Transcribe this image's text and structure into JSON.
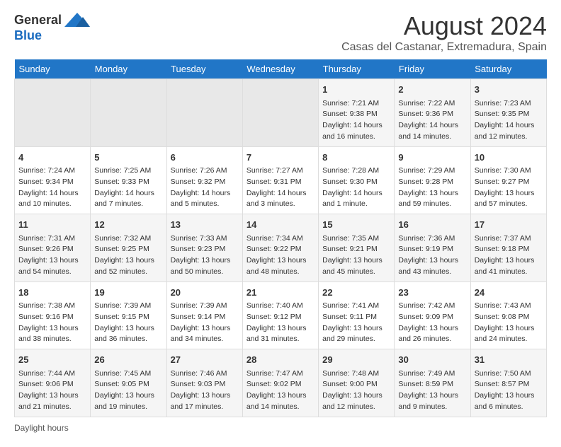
{
  "logo": {
    "general": "General",
    "blue": "Blue"
  },
  "title": "August 2024",
  "subtitle": "Casas del Castanar, Extremadura, Spain",
  "days_of_week": [
    "Sunday",
    "Monday",
    "Tuesday",
    "Wednesday",
    "Thursday",
    "Friday",
    "Saturday"
  ],
  "footer": "Daylight hours",
  "weeks": [
    [
      {
        "day": "",
        "info": ""
      },
      {
        "day": "",
        "info": ""
      },
      {
        "day": "",
        "info": ""
      },
      {
        "day": "",
        "info": ""
      },
      {
        "day": "1",
        "info": "Sunrise: 7:21 AM\nSunset: 9:38 PM\nDaylight: 14 hours and 16 minutes."
      },
      {
        "day": "2",
        "info": "Sunrise: 7:22 AM\nSunset: 9:36 PM\nDaylight: 14 hours and 14 minutes."
      },
      {
        "day": "3",
        "info": "Sunrise: 7:23 AM\nSunset: 9:35 PM\nDaylight: 14 hours and 12 minutes."
      }
    ],
    [
      {
        "day": "4",
        "info": "Sunrise: 7:24 AM\nSunset: 9:34 PM\nDaylight: 14 hours and 10 minutes."
      },
      {
        "day": "5",
        "info": "Sunrise: 7:25 AM\nSunset: 9:33 PM\nDaylight: 14 hours and 7 minutes."
      },
      {
        "day": "6",
        "info": "Sunrise: 7:26 AM\nSunset: 9:32 PM\nDaylight: 14 hours and 5 minutes."
      },
      {
        "day": "7",
        "info": "Sunrise: 7:27 AM\nSunset: 9:31 PM\nDaylight: 14 hours and 3 minutes."
      },
      {
        "day": "8",
        "info": "Sunrise: 7:28 AM\nSunset: 9:30 PM\nDaylight: 14 hours and 1 minute."
      },
      {
        "day": "9",
        "info": "Sunrise: 7:29 AM\nSunset: 9:28 PM\nDaylight: 13 hours and 59 minutes."
      },
      {
        "day": "10",
        "info": "Sunrise: 7:30 AM\nSunset: 9:27 PM\nDaylight: 13 hours and 57 minutes."
      }
    ],
    [
      {
        "day": "11",
        "info": "Sunrise: 7:31 AM\nSunset: 9:26 PM\nDaylight: 13 hours and 54 minutes."
      },
      {
        "day": "12",
        "info": "Sunrise: 7:32 AM\nSunset: 9:25 PM\nDaylight: 13 hours and 52 minutes."
      },
      {
        "day": "13",
        "info": "Sunrise: 7:33 AM\nSunset: 9:23 PM\nDaylight: 13 hours and 50 minutes."
      },
      {
        "day": "14",
        "info": "Sunrise: 7:34 AM\nSunset: 9:22 PM\nDaylight: 13 hours and 48 minutes."
      },
      {
        "day": "15",
        "info": "Sunrise: 7:35 AM\nSunset: 9:21 PM\nDaylight: 13 hours and 45 minutes."
      },
      {
        "day": "16",
        "info": "Sunrise: 7:36 AM\nSunset: 9:19 PM\nDaylight: 13 hours and 43 minutes."
      },
      {
        "day": "17",
        "info": "Sunrise: 7:37 AM\nSunset: 9:18 PM\nDaylight: 13 hours and 41 minutes."
      }
    ],
    [
      {
        "day": "18",
        "info": "Sunrise: 7:38 AM\nSunset: 9:16 PM\nDaylight: 13 hours and 38 minutes."
      },
      {
        "day": "19",
        "info": "Sunrise: 7:39 AM\nSunset: 9:15 PM\nDaylight: 13 hours and 36 minutes."
      },
      {
        "day": "20",
        "info": "Sunrise: 7:39 AM\nSunset: 9:14 PM\nDaylight: 13 hours and 34 minutes."
      },
      {
        "day": "21",
        "info": "Sunrise: 7:40 AM\nSunset: 9:12 PM\nDaylight: 13 hours and 31 minutes."
      },
      {
        "day": "22",
        "info": "Sunrise: 7:41 AM\nSunset: 9:11 PM\nDaylight: 13 hours and 29 minutes."
      },
      {
        "day": "23",
        "info": "Sunrise: 7:42 AM\nSunset: 9:09 PM\nDaylight: 13 hours and 26 minutes."
      },
      {
        "day": "24",
        "info": "Sunrise: 7:43 AM\nSunset: 9:08 PM\nDaylight: 13 hours and 24 minutes."
      }
    ],
    [
      {
        "day": "25",
        "info": "Sunrise: 7:44 AM\nSunset: 9:06 PM\nDaylight: 13 hours and 21 minutes."
      },
      {
        "day": "26",
        "info": "Sunrise: 7:45 AM\nSunset: 9:05 PM\nDaylight: 13 hours and 19 minutes."
      },
      {
        "day": "27",
        "info": "Sunrise: 7:46 AM\nSunset: 9:03 PM\nDaylight: 13 hours and 17 minutes."
      },
      {
        "day": "28",
        "info": "Sunrise: 7:47 AM\nSunset: 9:02 PM\nDaylight: 13 hours and 14 minutes."
      },
      {
        "day": "29",
        "info": "Sunrise: 7:48 AM\nSunset: 9:00 PM\nDaylight: 13 hours and 12 minutes."
      },
      {
        "day": "30",
        "info": "Sunrise: 7:49 AM\nSunset: 8:59 PM\nDaylight: 13 hours and 9 minutes."
      },
      {
        "day": "31",
        "info": "Sunrise: 7:50 AM\nSunset: 8:57 PM\nDaylight: 13 hours and 6 minutes."
      }
    ]
  ]
}
